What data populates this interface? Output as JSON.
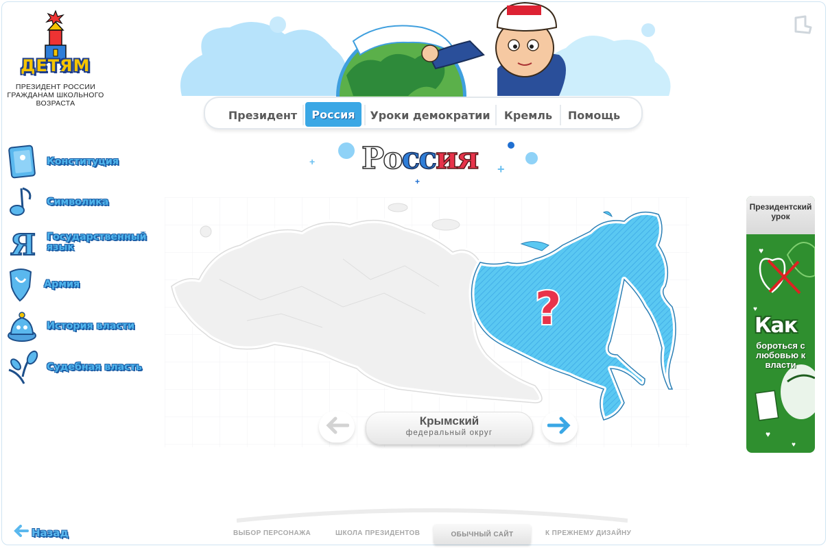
{
  "logo": {
    "text": "ДЕТЯМ",
    "tagline": "ПРЕЗИДЕНТ РОССИИ ГРАЖДАНАМ ШКОЛЬНОГО ВОЗРАСТА"
  },
  "sidebar": {
    "items": [
      {
        "label": "Конституция",
        "icon": "constitution-book-icon"
      },
      {
        "label": "Символика",
        "icon": "music-note-icon"
      },
      {
        "label": "Государственный язык",
        "icon": "letter-ya-icon"
      },
      {
        "label": "Армия",
        "icon": "army-shield-icon"
      },
      {
        "label": "История власти",
        "icon": "crown-hat-icon"
      },
      {
        "label": "Судебная власть",
        "icon": "branch-leaves-icon"
      }
    ]
  },
  "topnav": {
    "items": [
      {
        "label": "Президент"
      },
      {
        "label": "Россия",
        "active": true
      },
      {
        "label": "Уроки демократии"
      },
      {
        "label": "Кремль"
      },
      {
        "label": "Помощь"
      }
    ]
  },
  "page_title": "Россия",
  "map": {
    "highlight_color": "#5ac8f2",
    "question_mark": "?",
    "selected_district": {
      "name": "Крымский",
      "subtitle": "федеральный округ"
    }
  },
  "banner": {
    "title": "Президентский урок",
    "big": "Как",
    "sub": "бороться с любовью к власти"
  },
  "footer": {
    "links": [
      "ВЫБОР ПЕРСОНАЖА",
      "ШКОЛА ПРЕЗИДЕНТОВ",
      "ОБЫЧНЫЙ САЙТ",
      "К ПРЕЖНЕМУ ДИЗАЙНУ"
    ],
    "back": "Назад"
  },
  "colors": {
    "accent": "#3aa7e5",
    "banner_green": "#2f8f2f",
    "title_red": "#e8334a"
  }
}
